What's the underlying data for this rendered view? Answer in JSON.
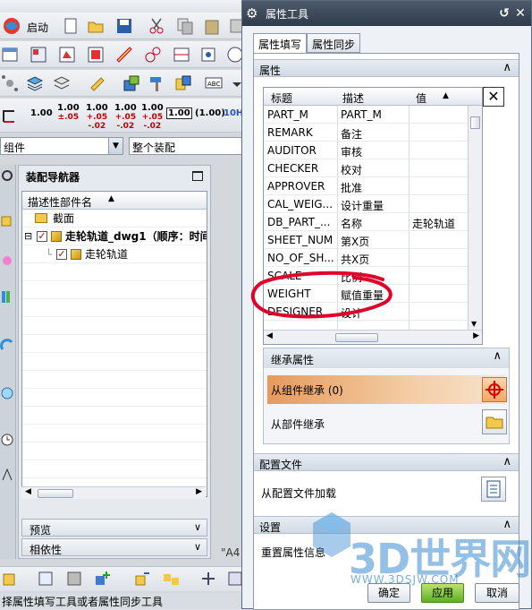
{
  "app": {
    "menu": [
      "",
      "",
      ""
    ],
    "start_label": "启动",
    "format_buttons": [
      {
        "main": "1.00",
        "sub": ""
      },
      {
        "main": "1.00",
        "sub": "±.05"
      },
      {
        "main": "1.00",
        "sub": "+.05\n-.02"
      },
      {
        "main": "1.00",
        "sub": "+.05\n-.02"
      },
      {
        "main": "1.00",
        "sub": "+.05\n-.02"
      },
      {
        "main": "1.00",
        "sub": ""
      },
      {
        "main": "(1.00)",
        "sub": ""
      },
      {
        "main": "10H",
        "sub": ""
      }
    ],
    "filter_combo": "组件",
    "scope_combo": "整个装配",
    "navigator": {
      "title": "装配导航器",
      "column_header": "描述性部件名",
      "rows": [
        {
          "label": "截面",
          "level": 0
        },
        {
          "label": "走轮轨道_dwg1（顺序：时间",
          "level": 0
        },
        {
          "label": "走轮轨道",
          "level": 1
        }
      ],
      "sections": [
        "预览",
        "相依性"
      ]
    },
    "canvas_label": "\"A4",
    "status_text": "择属性填写工具或者属性同步工具"
  },
  "dialog": {
    "title": "属性工具",
    "tabs": [
      "属性填写",
      "属性同步"
    ],
    "group_attributes": "属性",
    "table": {
      "headers": [
        "标题",
        "描述",
        "值"
      ],
      "rows": [
        {
          "title": "PART_M",
          "desc": "PART_M",
          "value": ""
        },
        {
          "title": "REMARK",
          "desc": "备注",
          "value": ""
        },
        {
          "title": "AUDITOR",
          "desc": "审核",
          "value": ""
        },
        {
          "title": "CHECKER",
          "desc": "校对",
          "value": ""
        },
        {
          "title": "APPROVER",
          "desc": "批准",
          "value": ""
        },
        {
          "title": "CAL_WEIG...",
          "desc": "设计重量",
          "value": ""
        },
        {
          "title": "DB_PART_...",
          "desc": "名称",
          "value": "走轮轨道"
        },
        {
          "title": "SHEET_NUM",
          "desc": "第X页",
          "value": ""
        },
        {
          "title": "NO_OF_SH...",
          "desc": "共X页",
          "value": ""
        },
        {
          "title": "SCALE",
          "desc": "比例",
          "value": ""
        },
        {
          "title": "WEIGHT",
          "desc": "赋值重量",
          "value": ""
        },
        {
          "title": "DESIGNER",
          "desc": "设计",
          "value": ""
        },
        {
          "title": "...",
          "desc": "...",
          "value": ""
        }
      ]
    },
    "inherit": {
      "title": "继承属性",
      "from_component": "从组件继承 (0)",
      "from_part": "从部件继承"
    },
    "config": {
      "title": "配置文件",
      "load_label": "从配置文件加载"
    },
    "settings": {
      "title": "设置",
      "partial_label": "重置属性信息"
    },
    "buttons": {
      "ok": "确定",
      "apply": "应用",
      "cancel": "取消"
    },
    "colors": {
      "title_bar": "#34404f",
      "highlight": "#e79a5c",
      "annotation": "#e0002a"
    }
  },
  "watermark": {
    "text": "3D世界网",
    "url": "WWW.3DSJW.COM"
  }
}
